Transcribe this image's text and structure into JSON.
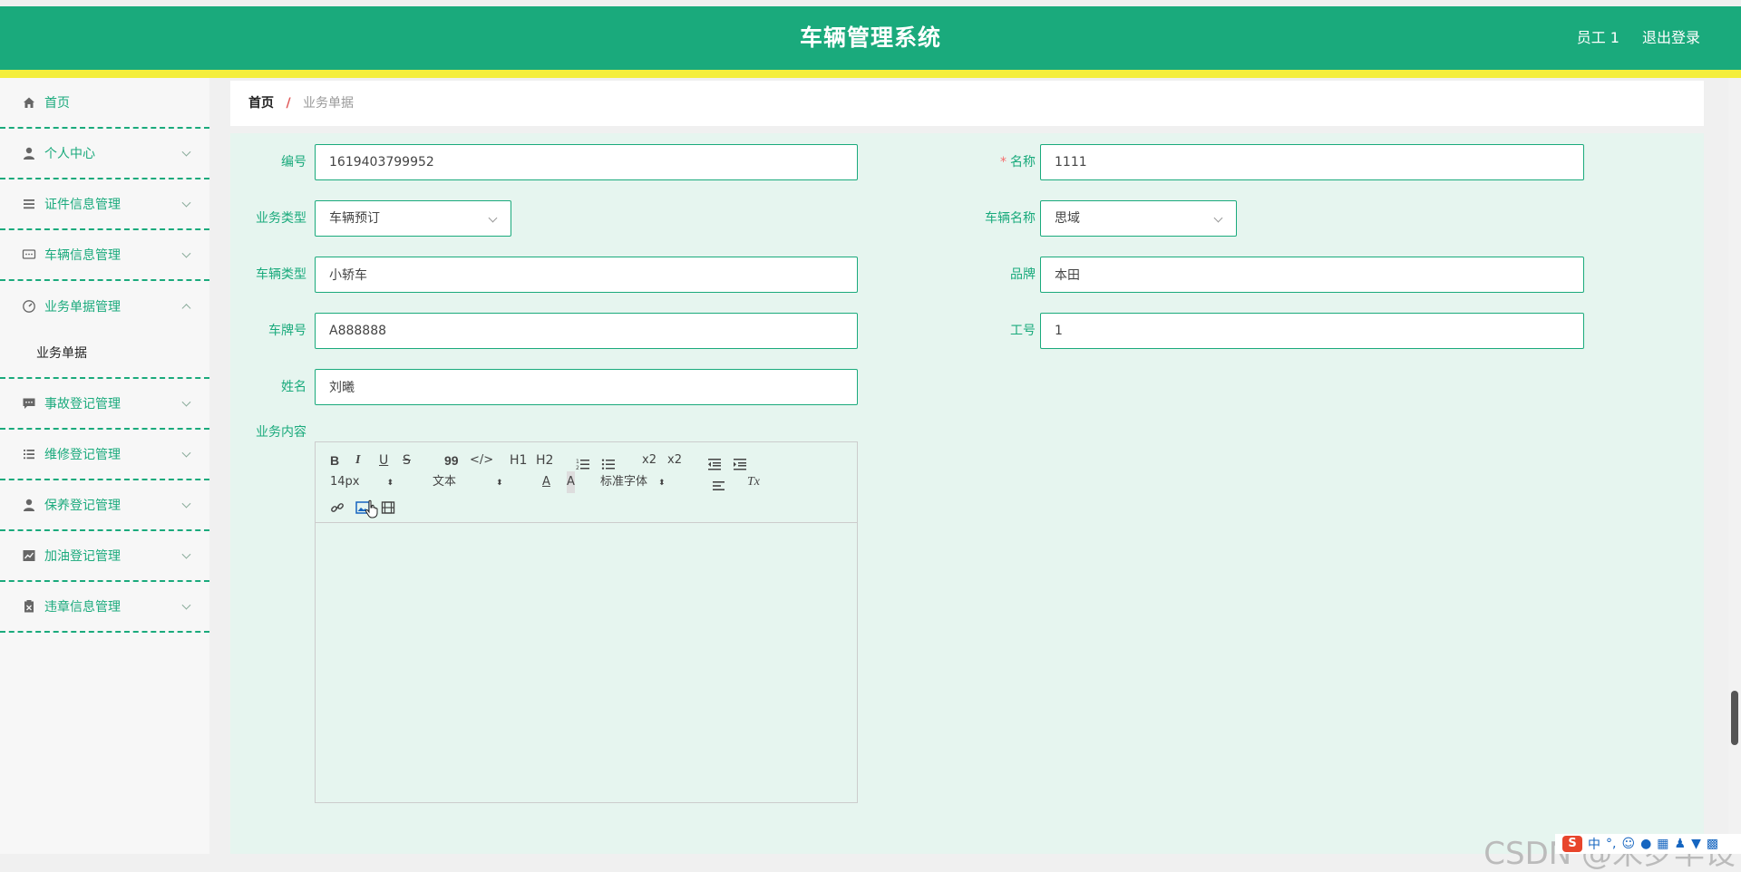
{
  "header": {
    "title": "车辆管理系统",
    "user": "员工 1",
    "logout": "退出登录"
  },
  "sidebar": {
    "items": [
      {
        "label": "首页",
        "icon": "home-icon"
      },
      {
        "label": "个人中心",
        "icon": "user-icon"
      },
      {
        "label": "证件信息管理",
        "icon": "list-icon"
      },
      {
        "label": "车辆信息管理",
        "icon": "chat-icon"
      },
      {
        "label": "业务单据管理",
        "icon": "speedometer-icon",
        "open": true,
        "sub": "业务单据"
      },
      {
        "label": "事故登记管理",
        "icon": "message-icon"
      },
      {
        "label": "维修登记管理",
        "icon": "list-check-icon"
      },
      {
        "label": "保养登记管理",
        "icon": "user-icon"
      },
      {
        "label": "加油登记管理",
        "icon": "chart-icon"
      },
      {
        "label": "违章信息管理",
        "icon": "clipboard-icon"
      }
    ]
  },
  "breadcrumb": {
    "home": "首页",
    "sep": "/",
    "current": "业务单据"
  },
  "form": {
    "number_label": "编号",
    "number_value": "1619403799952",
    "name_label": "名称",
    "name_required": "*",
    "name_value": "1111",
    "type_label": "业务类型",
    "type_value": "车辆预订",
    "vehicle_label": "车辆名称",
    "vehicle_value": "思域",
    "vehicle_type_label": "车辆类型",
    "vehicle_type_value": "小轿车",
    "brand_label": "品牌",
    "brand_value": "本田",
    "plate_label": "车牌号",
    "plate_value": "A888888",
    "worker_id_label": "工号",
    "worker_id_value": "1",
    "fullname_label": "姓名",
    "fullname_value": "刘曦",
    "content_label": "业务内容"
  },
  "editor": {
    "font_size": "14px",
    "format": "文本",
    "font_family": "标准字体",
    "tools": [
      "B",
      "I",
      "U",
      "S",
      "99",
      "</>",
      "H1",
      "H2",
      "x2",
      "x2",
      "A",
      "Tx"
    ]
  },
  "watermark": "CSDN @米罗毕设",
  "tray": {
    "lang": "中"
  },
  "colors": {
    "primary": "#1aaa7c",
    "accent_bar": "#f4ee3c",
    "content_bg": "#e6f5ef",
    "required": "#f56c6c"
  }
}
